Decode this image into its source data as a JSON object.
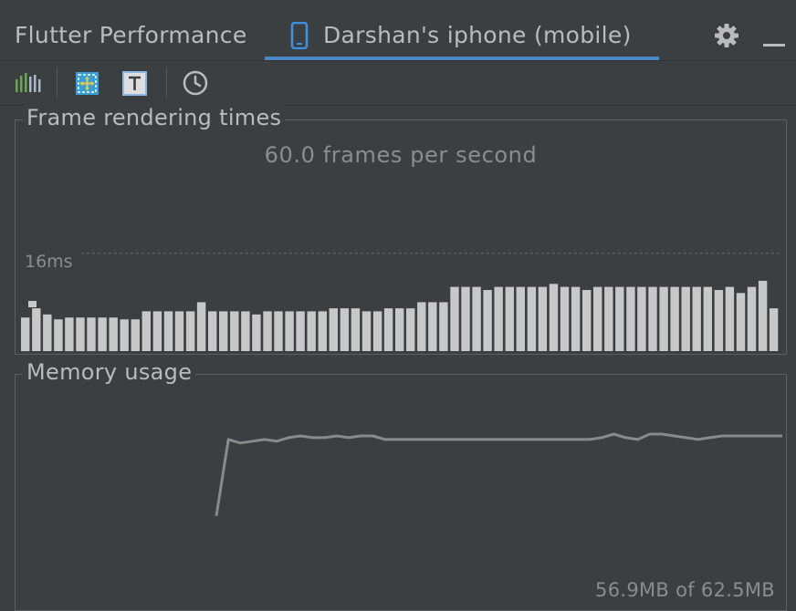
{
  "header": {
    "tool_title": "Flutter Performance",
    "tab_label": "Darshan's iphone (mobile)"
  },
  "icons": {
    "phone": "mobile-phone-icon",
    "settings": "gear-icon",
    "minimize": "minimize-icon",
    "performance_overlay": "bar-chart-icon",
    "debug_paint": "layout-grid-icon",
    "repaint_rainbow": "text-t-icon",
    "slow_animations": "clock-icon"
  },
  "colors": {
    "accent": "#4a88c7",
    "bars": "#c8c8c8",
    "memory_line": "#8a8a8a",
    "panel_bg": "#3c3f41"
  },
  "frame_panel": {
    "title": "Frame rendering times",
    "fps_text": "60.0 frames per second",
    "threshold_label": "16ms"
  },
  "memory_panel": {
    "title": "Memory usage",
    "usage_text": "56.9MB of 62.5MB"
  },
  "chart_data": [
    {
      "type": "bar",
      "title": "Frame rendering times",
      "threshold_ms": 16,
      "ylim": [
        0,
        40
      ],
      "values": [
        5.5,
        7,
        6,
        5.2,
        5.5,
        5.5,
        5.5,
        5.5,
        5.5,
        5.2,
        5.2,
        6.5,
        6.5,
        6.5,
        6.5,
        6.5,
        8,
        6.5,
        6.5,
        6.5,
        6.5,
        6,
        6.5,
        6.5,
        6.5,
        6.5,
        6.5,
        6.5,
        7,
        7,
        7,
        6.5,
        6.5,
        7,
        7,
        7,
        8,
        8,
        8,
        10.5,
        10.5,
        10.5,
        10,
        10.5,
        10.5,
        10.5,
        10.5,
        10.5,
        11,
        10.5,
        10.5,
        10,
        10.5,
        10.5,
        10.5,
        10.5,
        10.5,
        10.5,
        10.5,
        10.5,
        10.5,
        10.5,
        10.5,
        10,
        10.5,
        9.5,
        10.5,
        11.5,
        7
      ]
    },
    {
      "type": "line",
      "title": "Memory usage",
      "usage": "56.9MB of 62.5MB",
      "max_mb": 62.5,
      "values": [
        36,
        57.5,
        56.5,
        57,
        57.5,
        57,
        58,
        58.5,
        58,
        58,
        58.5,
        58,
        58.5,
        58.5,
        57.5,
        57.5,
        57.5,
        57.5,
        57.5,
        57.5,
        57.5,
        57.5,
        57.5,
        57.5,
        57.5,
        57.5,
        57.5,
        57.5,
        57.5,
        57.5,
        57.5,
        57.5,
        58,
        59,
        58,
        57.5,
        59,
        59,
        58.5,
        58,
        57.5,
        58,
        58.5,
        58.5,
        58.5,
        58.5,
        58.5,
        58.5
      ]
    }
  ]
}
